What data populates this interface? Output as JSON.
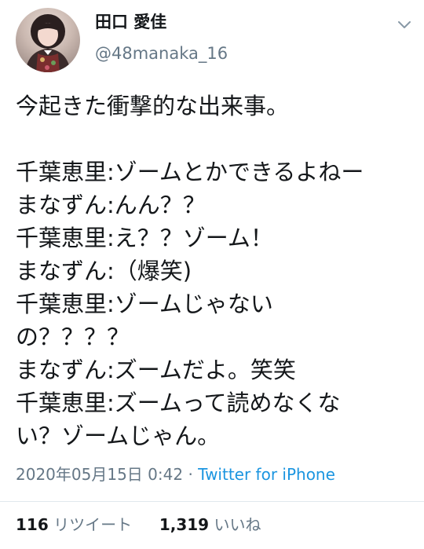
{
  "user": {
    "display_name": "田口 愛佳",
    "handle": "@48manaka_16"
  },
  "tweet": {
    "lines": [
      "今起きた衝撃的な出来事。",
      "",
      "千葉恵里:ゾームとかできるよねー",
      "まなずん:んん？？",
      "千葉恵里:え？？ゾーム！",
      "まなずん:（爆笑)",
      "千葉恵里:ゾームじゃない",
      "の？？？？",
      "まなずん:ズームだよ。笑笑",
      "千葉恵里:ズームって読めなくな",
      "い？ゾームじゃん。"
    ],
    "timestamp": "2020年05月15日 0:42",
    "separator": "·",
    "source": "Twitter for iPhone"
  },
  "stats": {
    "retweets_count": "116",
    "retweets_label": "リツイート",
    "likes_count": "1,319",
    "likes_label": "いいね"
  },
  "icons": {
    "menu": "chevron-down-icon",
    "avatar": "profile-photo"
  },
  "colors": {
    "text": "#14171a",
    "secondary": "#657786",
    "link": "#1b95e0",
    "divider": "#e1e8ed"
  }
}
